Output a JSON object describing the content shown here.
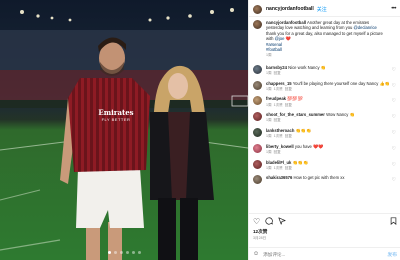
{
  "post": {
    "author": "nancyjordanfootball",
    "follow_label": "关注",
    "more_label": "•••"
  },
  "caption": {
    "author": "nancyjordanfootball",
    "text_1": "Another great day at the emirates yesterday love watching and learning from you",
    "mention": "@declanrice",
    "text_2": "thank you for a great day, also managed to get myself a picture with",
    "mention_2": "@joe",
    "hashtag_1": "#arsenal",
    "hashtag_2": "#football",
    "time": "1周"
  },
  "comments": [
    {
      "user": "barnsby24",
      "text": "Nice work Nancy 👏",
      "time": "1周",
      "reply": "回复"
    },
    {
      "user": "chappers_15",
      "text": "You'll be playing there yourself one day Nancy 👍👏",
      "time": "1周",
      "likes": "1次赞",
      "reply": "回复"
    },
    {
      "user": "freudpeak",
      "text": "💯💯💯",
      "time": "1周",
      "likes": "1次赞",
      "reply": "回复"
    },
    {
      "user": "shoot_for_the_stars_summer",
      "text": "Wow Nancy 👏",
      "time": "1周",
      "reply": "回复"
    },
    {
      "user": "lankstheroach",
      "text": "👏👏👏",
      "time": "1周",
      "likes": "1次赞",
      "reply": "回复"
    },
    {
      "user": "liberty_kowell",
      "text": "you have ❤️❤️",
      "time": "1周",
      "reply": "回复"
    },
    {
      "user": "bladelilFl_uk",
      "text": "👏👏👏",
      "time": "1周",
      "likes": "1次赞",
      "reply": "回复"
    },
    {
      "user": "shakira36576",
      "text": "How to get pic with them xx",
      "time": "",
      "reply": ""
    }
  ],
  "actions": {
    "like_icon": "heart-outline-icon",
    "comment_icon": "comment-bubble-icon",
    "share_icon": "paper-plane-icon",
    "save_icon": "bookmark-icon",
    "likes": "12次赞",
    "date": "3月28日"
  },
  "composer": {
    "emoji_icon": "smiley-icon",
    "placeholder": "添加评论...",
    "post_label": "发布"
  },
  "photo": {
    "shirt_brand": "Emirates",
    "shirt_slogan": "FLY BETTER",
    "total_slides": 6,
    "active_slide": 1
  },
  "colors": {
    "accent": "#0095f6",
    "muted": "#8e8e8e",
    "kit_red": "#8e1b24"
  }
}
